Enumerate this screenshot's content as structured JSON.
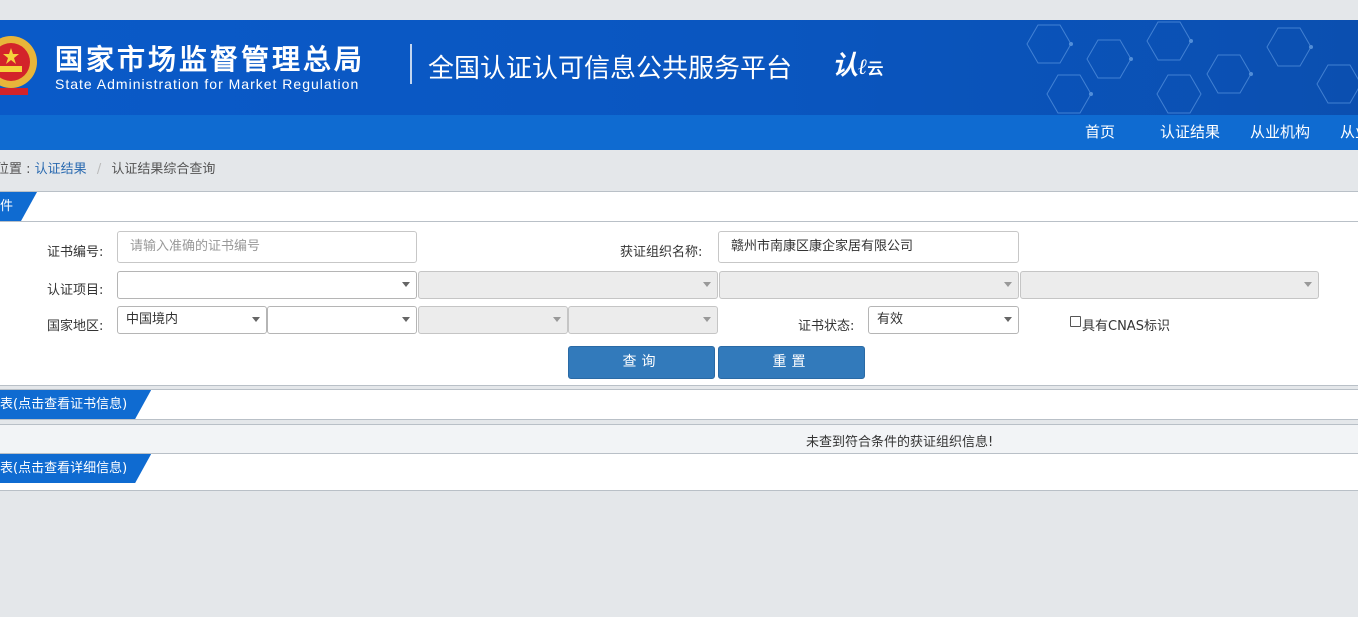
{
  "header": {
    "org_name_cn": "国家市场监督管理总局",
    "org_name_en": "State Administration  for  Market Regulation",
    "platform_title": "全国认证认可信息公共服务平台",
    "platform_logo_text": "认",
    "platform_logo_sub": "云"
  },
  "nav": {
    "items": [
      {
        "label": "首页"
      },
      {
        "label": "认证结果"
      },
      {
        "label": "从业机构"
      },
      {
        "label": "从业"
      }
    ]
  },
  "breadcrumb": {
    "prefix": "位置 :",
    "link": "认证结果",
    "separator": "/",
    "current": "认证结果综合查询"
  },
  "query_panel": {
    "title": "件",
    "cert_no_label": "证书编号:",
    "cert_no_placeholder": "请输入准确的证书编号",
    "org_name_label": "获证组织名称:",
    "org_name_value": "赣州市南康区康企家居有限公司",
    "cert_item_label": "认证项目:",
    "country_label": "国家地区:",
    "country_value": "中国境内",
    "status_label": "证书状态:",
    "status_value": "有效",
    "cnas_label": "具有CNAS标识",
    "search_button": "查询",
    "reset_button": "重置"
  },
  "results": {
    "cert_list_title": "表(点击查看证书信息)",
    "empty_message": "未查到符合条件的获证组织信息!",
    "detail_list_title": "表(点击查看详细信息)"
  },
  "colors": {
    "brand_blue": "#0f6bd1",
    "button_blue": "#327abb",
    "link_blue": "#2a6ab0",
    "page_bg": "#e4e7ea"
  }
}
